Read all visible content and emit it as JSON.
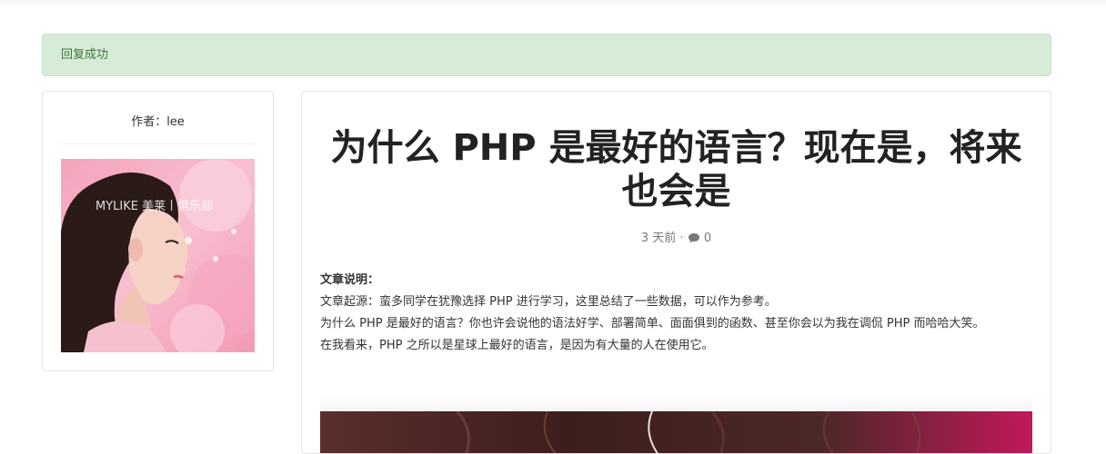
{
  "alert": {
    "message": "回复成功"
  },
  "author": {
    "label": "作者：lee",
    "avatar_watermark": "MYLIKE 美莱丨俱乐部"
  },
  "article": {
    "title": "为什么 PHP 是最好的语言？现在是，将来也会是",
    "meta": {
      "time": "3 天前",
      "separator": "·",
      "comment_count": "0",
      "comment_icon": "comment-icon"
    },
    "paragraphs": [
      {
        "label": "文章说明："
      },
      {
        "text": "文章起源：蛮多同学在犹豫选择 PHP 进行学习，这里总结了一些数据，可以作为参考。"
      },
      {
        "text": "为什么 PHP 是最好的语言？你也许会说他的语法好学、部署简单、面面俱到的函数、甚至你会以为我在调侃 PHP 而哈哈大笑。"
      },
      {
        "text": "在我看来，PHP 之所以是星球上最好的语言，是因为有大量的人在使用它。"
      }
    ]
  },
  "colors": {
    "alert_bg": "#d7ecd8",
    "alert_text": "#3c763d",
    "border": "#e4e4e4"
  }
}
